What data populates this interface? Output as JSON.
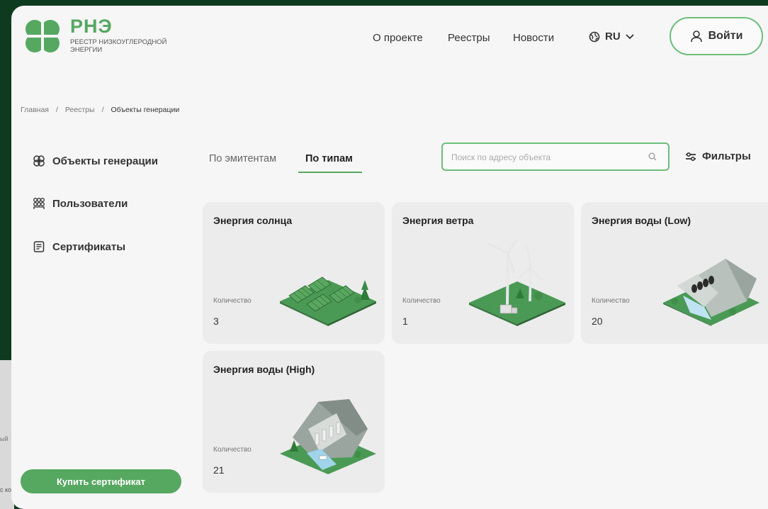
{
  "brand": {
    "title": "РНЭ",
    "subtitle": "РЕЕСТР НИЗКОУГЛЕРОДНОЙ ЭНЕРГИИ",
    "logo_icon": "clover-logo-icon",
    "color": "#56a861"
  },
  "nav": {
    "about": "О проекте",
    "registers": "Реестры",
    "news": "Новости",
    "language": "RU",
    "login": "Войти"
  },
  "breadcrumb": [
    "Главная",
    "/",
    "Реестры",
    "/",
    "Объекты генерации"
  ],
  "sidebar": {
    "items": [
      {
        "label": "Объекты генерации",
        "icon": "generation-icon"
      },
      {
        "label": "Пользователи",
        "icon": "users-icon"
      },
      {
        "label": "Сертификаты",
        "icon": "certificate-icon"
      }
    ],
    "buy_button": "Купить сертификат"
  },
  "tabs": {
    "emitters": "По эмитентам",
    "types": "По типам",
    "active": "types"
  },
  "search": {
    "placeholder": "Поиск по адресу объекта",
    "value": ""
  },
  "filters_label": "Фильтры",
  "cards": [
    {
      "title": "Энергия солнца",
      "count_label": "Количество",
      "count": "3"
    },
    {
      "title": "Энергия ветра",
      "count_label": "Количество",
      "count": "1"
    },
    {
      "title": "Энергия воды (Low)",
      "count_label": "Количество",
      "count": "20"
    },
    {
      "title": "Энергия воды (High)",
      "count_label": "Количество",
      "count": "21"
    }
  ],
  "background_text": {
    "line1": "ый",
    "line2": "с ко"
  }
}
